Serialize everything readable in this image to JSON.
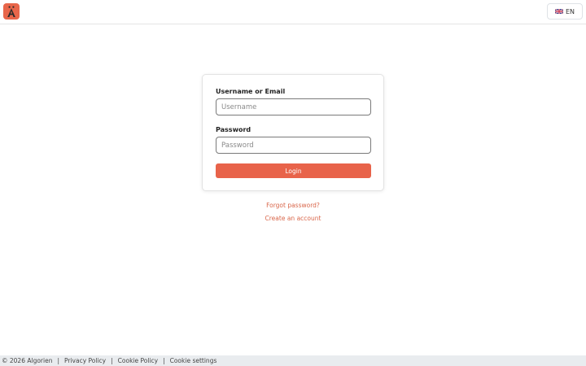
{
  "header": {
    "logo_icon": "algorien-logo-icon",
    "language": {
      "flag_icon": "uk-flag-icon",
      "code": "EN"
    }
  },
  "login_form": {
    "username_label": "Username or Email",
    "username_placeholder": "Username",
    "username_value": "",
    "password_label": "Password",
    "password_placeholder": "Password",
    "password_value": "",
    "login_label": "Login",
    "accent_color": "#e8634a"
  },
  "links": {
    "forgot_password": "Forgot password?",
    "create_account": "Create an account"
  },
  "footer": {
    "copyright": "© 2026 Algorien",
    "separator": "|",
    "privacy_policy": "Privacy Policy",
    "cookie_policy": "Cookie Policy",
    "cookie_settings": "Cookie settings"
  }
}
